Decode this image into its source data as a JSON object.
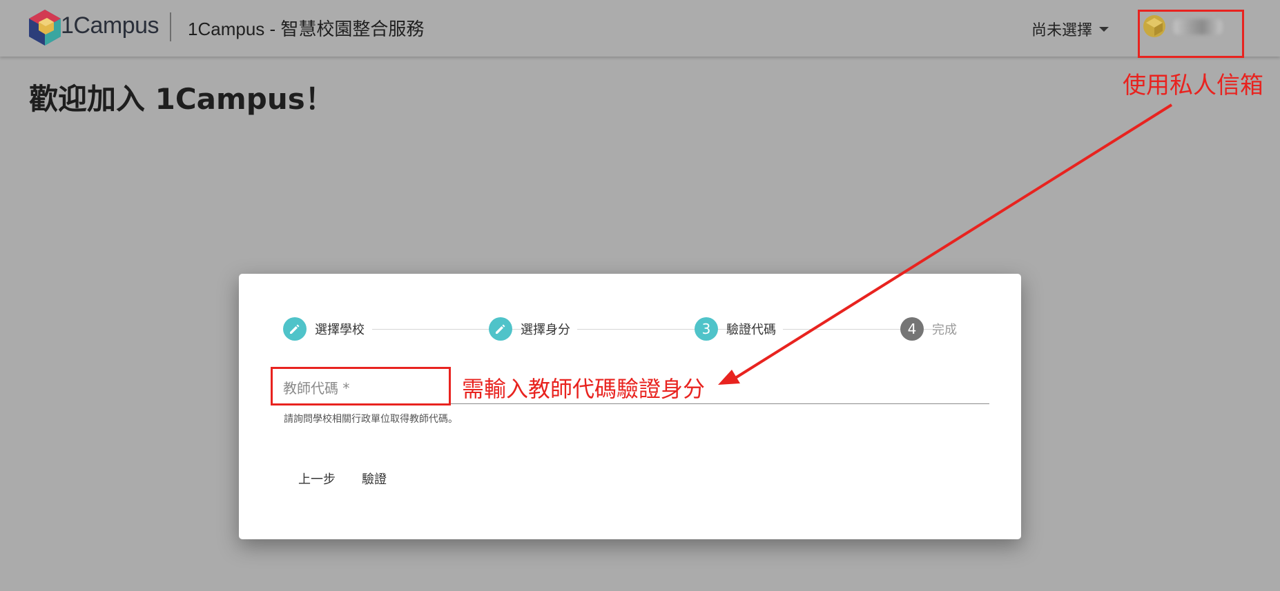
{
  "header": {
    "logo_text": "1Campus",
    "app_title": "1Campus - 智慧校園整合服務",
    "role_select_label": "尚未選擇"
  },
  "annotations": {
    "top_note": "使用私人信箱",
    "field_note": "需輸入教師代碼驗證身分",
    "color": "#e8231f"
  },
  "page": {
    "welcome": "歡迎加入 1Campus！"
  },
  "stepper": {
    "steps": [
      {
        "number": "",
        "icon": "pencil-icon",
        "label": "選擇學校",
        "state": "done"
      },
      {
        "number": "",
        "icon": "pencil-icon",
        "label": "選擇身分",
        "state": "done"
      },
      {
        "number": "3",
        "icon": "",
        "label": "驗證代碼",
        "state": "active"
      },
      {
        "number": "4",
        "icon": "",
        "label": "完成",
        "state": "pending"
      }
    ],
    "active_color": "#4fc3c9",
    "pending_color": "#757575"
  },
  "form": {
    "field_placeholder": "教師代碼 *",
    "field_value": "",
    "helper_text": "請詢問學校相關行政單位取得教師代碼。",
    "back_label": "上一步",
    "verify_label": "驗證"
  }
}
